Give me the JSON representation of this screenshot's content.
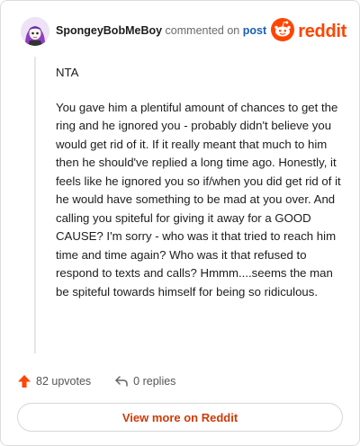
{
  "header": {
    "username": "SpongeyBobMeBoy",
    "action_text": "commented on",
    "post_link": "post",
    "brand": "reddit"
  },
  "comment": {
    "paragraphs": [
      "NTA",
      "You gave him a plentiful amount of chances to get the ring and he ignored you - probably didn't believe you would get rid of it. If it really meant that much to him then he should've replied a long time ago. Honestly, it feels like he ignored you so if/when you did get rid of it he would have something to be mad at you over. And calling you spiteful for giving it away for a GOOD CAUSE? I'm sorry - who was it that tried to reach him time and time again? Who was it that refused to respond to texts and calls? Hmmm....seems the man be spiteful towards himself for being so ridiculous."
    ]
  },
  "actions": {
    "upvotes": "82 upvotes",
    "replies": "0 replies"
  },
  "footer": {
    "view_more": "View more on Reddit"
  },
  "colors": {
    "brand": "#ff4500",
    "link": "#1a5fb4",
    "button_text": "#d03a07"
  }
}
